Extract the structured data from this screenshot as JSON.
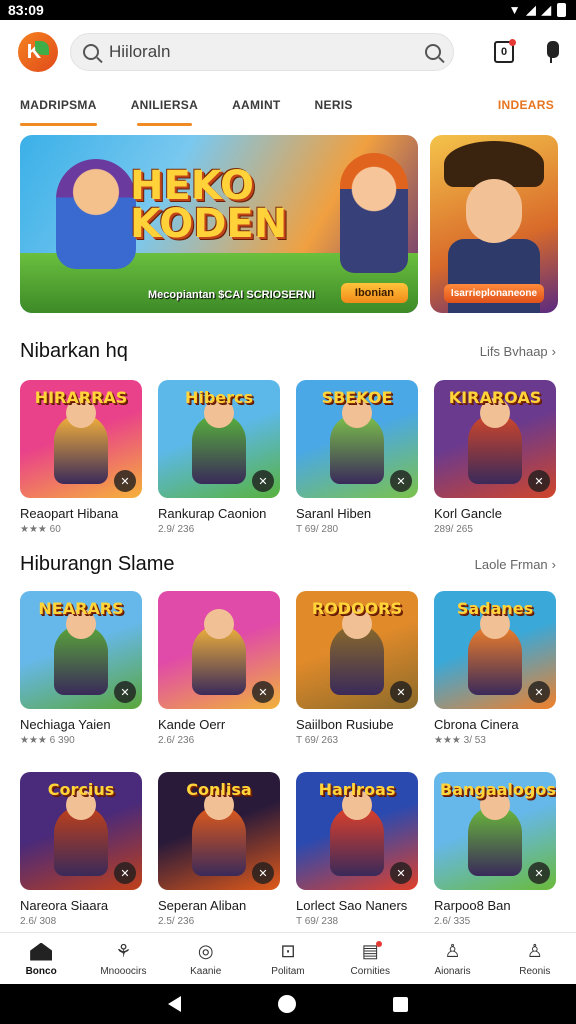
{
  "status": {
    "time": "83:09"
  },
  "search": {
    "value": "Hiiloraln"
  },
  "tabs": [
    {
      "label": "MADRIPSMA"
    },
    {
      "label": "ANILIERSA"
    },
    {
      "label": "AAMINT"
    },
    {
      "label": "NERIS"
    },
    {
      "label": "INDEARS"
    }
  ],
  "banner": {
    "title_line1": "HEKO",
    "title_line2": "KODEN",
    "subtitle": "Mecopiantan $CAI SCRIOSERNI",
    "button": "Ibonian",
    "side_button": "Isarrieplonaneone"
  },
  "section1": {
    "title": "Nibarkan hq",
    "link": "Lifs Bvhaap",
    "games": [
      {
        "title": "HIRARRAS",
        "name": "Reaopart Hibana",
        "meta": "★★★ 60",
        "colors": [
          "#e9418a",
          "#f6b23a"
        ]
      },
      {
        "title": "Hibercs",
        "name": "Rankurap Caonion",
        "meta": "2.9/ 236",
        "colors": [
          "#5cb8e8",
          "#58b23c"
        ]
      },
      {
        "title": "SBEKOE",
        "name": "Saranl Hiben",
        "meta": "T 69/ 280",
        "colors": [
          "#4aa8e6",
          "#7cc24a"
        ]
      },
      {
        "title": "KIRAROAS",
        "name": "Korl Gancle",
        "meta": "289/ 265",
        "colors": [
          "#6a3a8e",
          "#d0462a"
        ]
      }
    ]
  },
  "section2": {
    "title": "Hiburangn Slame",
    "link": "Laole Frman",
    "games": [
      {
        "title": "NEARARS",
        "name": "Nechiaga Yaien",
        "meta": "★★★ 6 390",
        "colors": [
          "#66b8ea",
          "#5aa63a"
        ]
      },
      {
        "title": "",
        "name": "Kande Oerr",
        "meta": "2.6/ 236",
        "colors": [
          "#e04aa8",
          "#f0b23a"
        ]
      },
      {
        "title": "RODOORS",
        "name": "Saiilbon Rusiube",
        "meta": "T 69/ 263",
        "colors": [
          "#e08a2a",
          "#8a6a2a"
        ]
      },
      {
        "title": "Sadanes",
        "name": "Cbrona Cinera",
        "meta": "★★★ 3/ 53",
        "colors": [
          "#3aa8d8",
          "#f0802a"
        ]
      }
    ]
  },
  "section3": {
    "games": [
      {
        "title": "Corcius",
        "name": "Nareora Siaara",
        "meta": "2.6/ 308",
        "colors": [
          "#4a2a7a",
          "#c0401a"
        ]
      },
      {
        "title": "Conlisa",
        "name": "Seperan Aliban",
        "meta": "2.5/ 236",
        "colors": [
          "#2a1a3a",
          "#e05a1a"
        ]
      },
      {
        "title": "Harlroas",
        "name": "Lorlect Sao Naners",
        "meta": "T 69/ 238",
        "colors": [
          "#2a4ab0",
          "#e0402a"
        ]
      },
      {
        "title": "Bangaalogos",
        "name": "Rarpoo8 Ban",
        "meta": "2.6/ 335",
        "colors": [
          "#66b8ea",
          "#6aba3a"
        ]
      }
    ]
  },
  "bottom_nav": [
    {
      "label": "Bonco",
      "icon": "home-icon"
    },
    {
      "label": "Mnooocirs",
      "icon": "categories-icon"
    },
    {
      "label": "Kaanie",
      "icon": "discover-icon"
    },
    {
      "label": "Politam",
      "icon": "games-icon"
    },
    {
      "label": "Cornities",
      "icon": "library-icon"
    },
    {
      "label": "Aionaris",
      "icon": "account-icon"
    },
    {
      "label": "Reonis",
      "icon": "profile-icon"
    }
  ]
}
